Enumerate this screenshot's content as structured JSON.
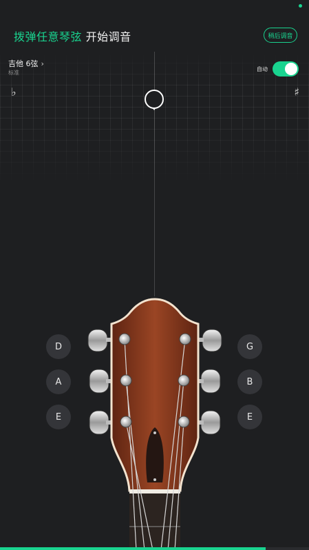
{
  "header": {
    "title_accent": "拨弹任意琴弦",
    "title_rest": "开始调音",
    "later_button": "稍后调音"
  },
  "tuning": {
    "instrument": "吉他 6弦",
    "chevron": "›",
    "mode": "标准"
  },
  "auto_toggle": {
    "label": "自动",
    "enabled": true
  },
  "meter": {
    "flat_symbol": "♭",
    "sharp_symbol": "♯"
  },
  "strings": {
    "left": [
      "D",
      "A",
      "E"
    ],
    "right": [
      "G",
      "B",
      "E"
    ]
  },
  "progress": {
    "fraction": 0.86
  },
  "colors": {
    "accent": "#19d38f",
    "background": "#1e1f21",
    "note_button": "#343539",
    "headstock_wood": "#8a3a1e"
  },
  "icons": {
    "chevron": "chevron-right-icon",
    "pointer": "tuning-pointer-icon"
  }
}
